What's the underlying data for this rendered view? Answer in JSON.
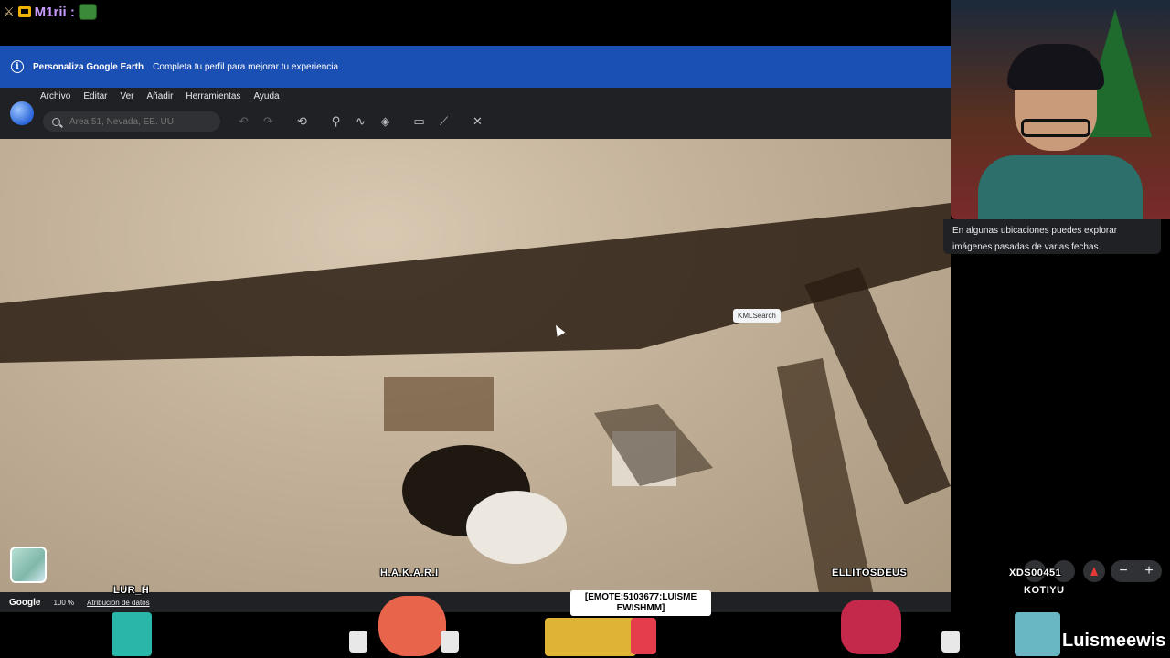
{
  "stream_chat": {
    "username": "M1rii :"
  },
  "banner": {
    "title": "Personaliza Google Earth",
    "subtitle": "Completa tu perfil para mejorar tu experiencia"
  },
  "menu": {
    "items": [
      "Archivo",
      "Editar",
      "Ver",
      "Añadir",
      "Herramientas",
      "Ayuda"
    ]
  },
  "search": {
    "placeholder": "Área 51, Nevada, EE. UU."
  },
  "toolbar": {
    "icons": [
      "undo-icon",
      "redo-icon",
      "history-icon",
      "placemark-icon",
      "path-icon",
      "layers-icon",
      "ruler-icon",
      "chart-icon",
      "satellite-icon"
    ]
  },
  "map": {
    "tooltip": "KMLSearch"
  },
  "statusbar": {
    "logo": "Google",
    "zoom": "100 %",
    "attribution": "Atribución de datos"
  },
  "tip": {
    "text": "En algunas ubicaciones puedes explorar imágenes pasadas de varias fechas."
  },
  "viewers": {
    "lur": "LUR_H",
    "hakari": "H.A.K.A.R.I",
    "ellitos": "ELLITOSDEUS",
    "xd": "XDS00451",
    "kotiyu": "KOTIYU"
  },
  "emote": {
    "text": "[EMOTE:5103677:LUISME EWISHMM]"
  },
  "brand": {
    "text": "Luismeewis"
  },
  "colors": {
    "banner": "#1a4fb3",
    "app_bg": "#202124",
    "accent_red": "#e53935"
  }
}
